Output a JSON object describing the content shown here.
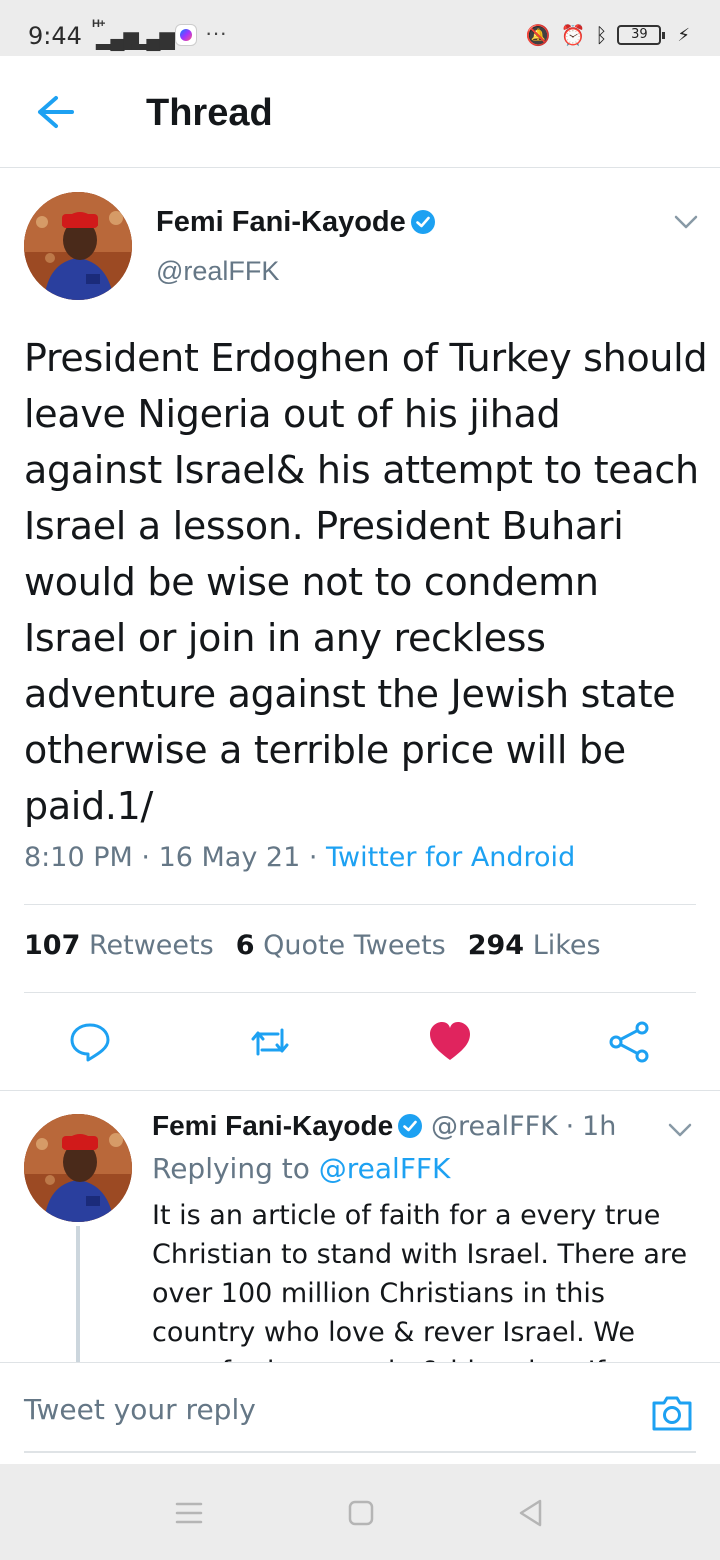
{
  "status_bar": {
    "time": "9:44",
    "signal_1": "H+",
    "battery": "39",
    "icons": [
      "messenger-icon",
      "more-icon",
      "mute-icon",
      "alarm-icon",
      "bluetooth-icon",
      "battery-icon",
      "charging-icon"
    ]
  },
  "header": {
    "title": "Thread"
  },
  "tweet": {
    "author": "Femi Fani-Kayode",
    "handle": "@realFFK",
    "text": "President Erdoghen of Turkey should leave Nigeria out of his jihad against Israel& his attempt to teach Israel a lesson.  President Buhari would be wise not to condemn Israel or join in any reckless adventure against the Jewish state otherwise a terrible price will be paid.1/",
    "time": "8:10 PM",
    "date": "16 May 21",
    "source": "Twitter for Android",
    "stats": {
      "retweets_count": "107",
      "retweets_label": "Retweets",
      "quotes_count": "6",
      "quotes_label": "Quote Tweets",
      "likes_count": "294",
      "likes_label": "Likes"
    },
    "liked": true
  },
  "reply": {
    "author": "Femi Fani-Kayode",
    "handle": "@realFFK",
    "age": "1h",
    "replying_prefix": "Replying to",
    "replying_to": "@realFFK",
    "text": "It is an article of faith for a every true Christian to stand with Israel. There are over 100 million Christians in this country who love & rever Israel. We pray for her people & bless her. If you"
  },
  "composer": {
    "placeholder": "Tweet your reply"
  },
  "colors": {
    "accent": "#1da1f2",
    "like": "#e0245e",
    "secondary_text": "#657786"
  }
}
